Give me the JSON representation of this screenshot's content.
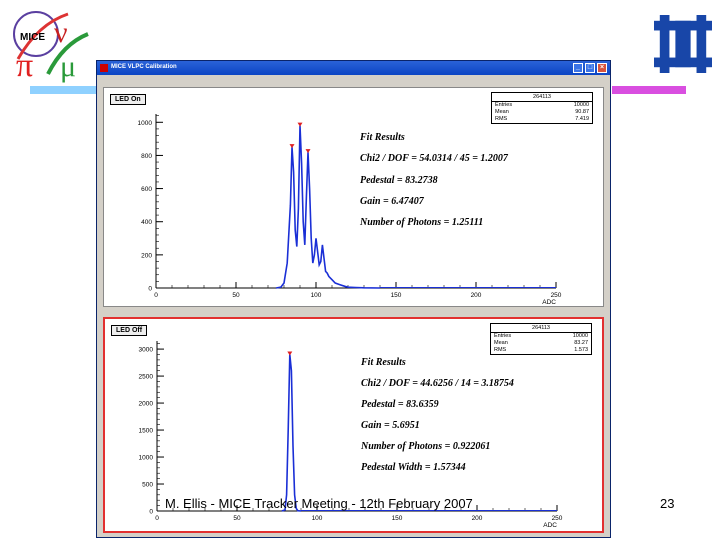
{
  "slide": {
    "footer": "M. Ellis - MICE Tracker Meeting - 12th February 2007",
    "page_number": "23",
    "logo_text": "MICE",
    "colors": {
      "deco_left": "#8fd1ff",
      "deco_right": "#d94fe0",
      "plot_line": "#1a2fd6",
      "peak_marker": "#e02020"
    }
  },
  "window": {
    "title": "MICE VLPC Calibration",
    "controls": [
      "minimize-icon",
      "maximize-icon",
      "close-icon"
    ]
  },
  "panels": [
    {
      "button_label": "LED On",
      "stats": {
        "title": "264113",
        "rows": [
          {
            "k": "Entries",
            "v": "10000"
          },
          {
            "k": "Mean",
            "v": "90.87"
          },
          {
            "k": "RMS",
            "v": "7.419"
          }
        ]
      },
      "fit": [
        "Fit Results",
        "Chi2 / DOF = 54.0314 / 45 = 1.2007",
        "Pedestal = 83.2738",
        "Gain = 6.47407",
        "Number of Photons = 1.25111"
      ]
    },
    {
      "button_label": "LED Off",
      "stats": {
        "title": "264113",
        "rows": [
          {
            "k": "Entries",
            "v": "10000"
          },
          {
            "k": "Mean",
            "v": "83.27"
          },
          {
            "k": "RMS",
            "v": "1.573"
          }
        ]
      },
      "fit": [
        "Fit Results",
        "Chi2 / DOF = 44.6256 / 14 = 3.18754",
        "Pedestal = 83.6359",
        "Gain = 5.6951",
        "Number of Photons = 0.922061",
        "Pedestal Width = 1.57344"
      ]
    }
  ],
  "chart_data": [
    {
      "type": "line",
      "xlabel": "ADC",
      "x_ticks": [
        0,
        50,
        100,
        150,
        200,
        250
      ],
      "y_ticks": [
        0,
        200,
        400,
        600,
        800,
        1000
      ],
      "xlim": [
        0,
        250
      ],
      "ylim": [
        0,
        1050
      ],
      "x": [
        75,
        78,
        80,
        82,
        84,
        85,
        86,
        87,
        88,
        89,
        90,
        91,
        92,
        93,
        94,
        95,
        96,
        97,
        98,
        99,
        100,
        101,
        102,
        103,
        104,
        105,
        106,
        107,
        108,
        110,
        112,
        115,
        118,
        120,
        125,
        130,
        140
      ],
      "values": [
        0,
        5,
        30,
        150,
        500,
        850,
        700,
        350,
        250,
        480,
        980,
        750,
        400,
        260,
        550,
        820,
        600,
        300,
        150,
        200,
        300,
        220,
        140,
        160,
        260,
        180,
        100,
        90,
        70,
        50,
        30,
        20,
        10,
        5,
        3,
        1,
        0
      ],
      "peaks": [
        {
          "x": 85,
          "y": 850
        },
        {
          "x": 90,
          "y": 980
        },
        {
          "x": 95,
          "y": 820
        }
      ]
    },
    {
      "type": "line",
      "xlabel": "ADC",
      "x_ticks": [
        0,
        50,
        100,
        150,
        200,
        250
      ],
      "y_ticks": [
        0,
        500,
        1000,
        1500,
        2000,
        2500,
        3000
      ],
      "xlim": [
        0,
        250
      ],
      "ylim": [
        0,
        3150
      ],
      "x": [
        78,
        80,
        81,
        82,
        83,
        84,
        85,
        86,
        87,
        88,
        90
      ],
      "values": [
        0,
        20,
        300,
        1500,
        2900,
        2600,
        1200,
        300,
        50,
        5,
        0
      ],
      "peaks": [
        {
          "x": 83,
          "y": 2900
        }
      ]
    }
  ]
}
